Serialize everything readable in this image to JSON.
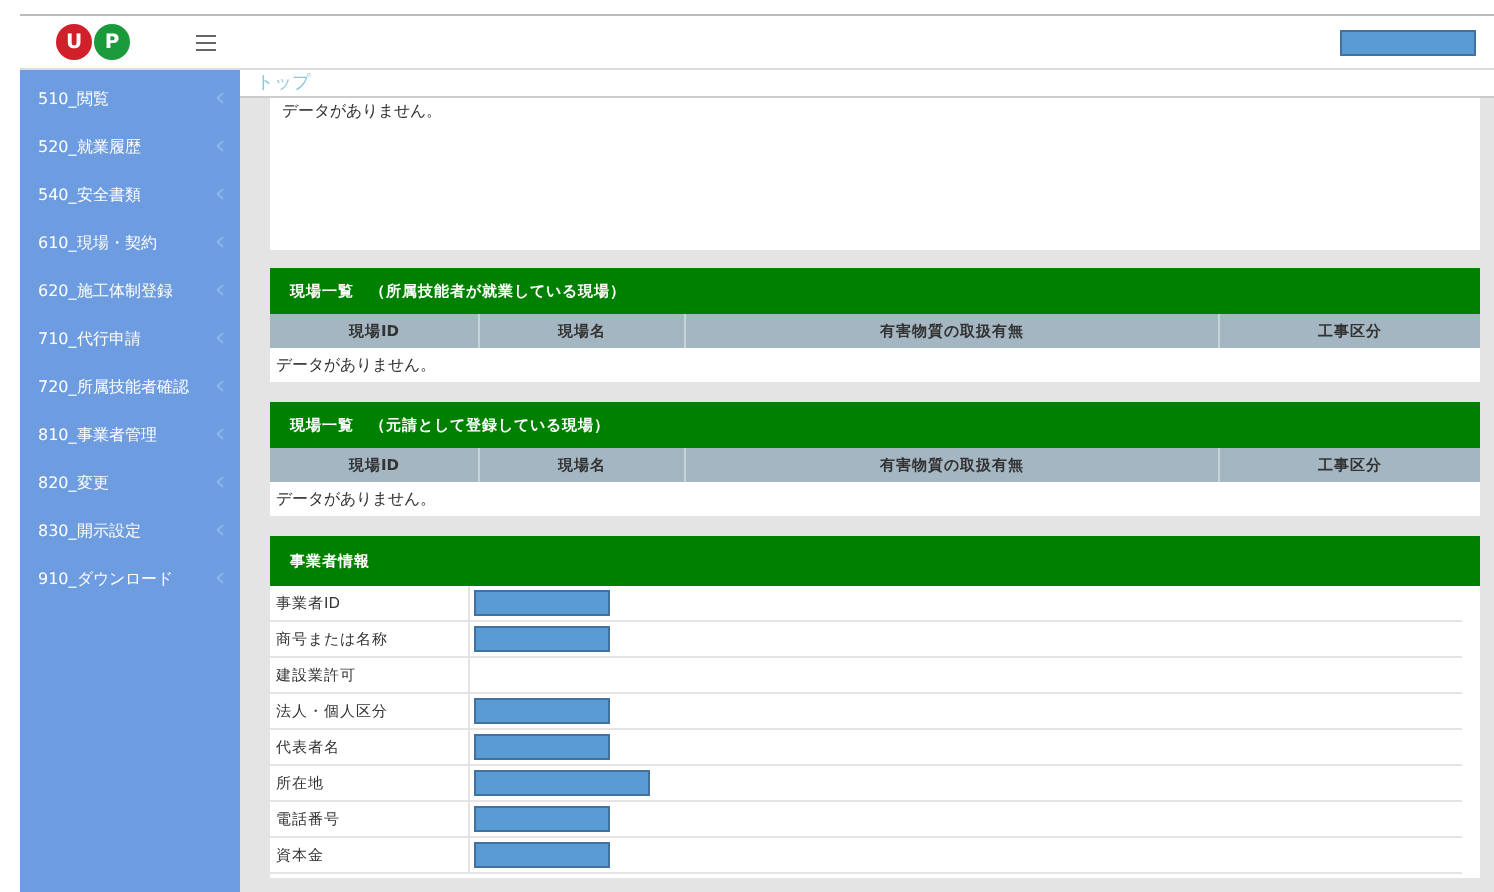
{
  "header": {
    "logo_letters": [
      "U",
      "P"
    ],
    "user_redacted": true
  },
  "sidebar": {
    "items": [
      {
        "label": "510_閲覧"
      },
      {
        "label": "520_就業履歴"
      },
      {
        "label": "540_安全書類"
      },
      {
        "label": "610_現場・契約"
      },
      {
        "label": "620_施工体制登録"
      },
      {
        "label": "710_代行申請"
      },
      {
        "label": "720_所属技能者確認"
      },
      {
        "label": "810_事業者管理"
      },
      {
        "label": "820_変更"
      },
      {
        "label": "830_開示設定"
      },
      {
        "label": "910_ダウンロード"
      }
    ]
  },
  "breadcrumb": "トップ",
  "top_panel": {
    "message": "データがありません。"
  },
  "site_tables": [
    {
      "title": "現場一覧　（所属技能者が就業している現場）",
      "columns": [
        "現場ID",
        "現場名",
        "有害物質の取扱有無",
        "工事区分"
      ],
      "empty_message": "データがありません。"
    },
    {
      "title": "現場一覧　（元請として登録している現場）",
      "columns": [
        "現場ID",
        "現場名",
        "有害物質の取扱有無",
        "工事区分"
      ],
      "empty_message": "データがありません。"
    }
  ],
  "company_info": {
    "title": "事業者情報",
    "rows": [
      {
        "label": "事業者ID",
        "redacted": true
      },
      {
        "label": "商号または名称",
        "redacted": true
      },
      {
        "label": "建設業許可",
        "redacted": false
      },
      {
        "label": "法人・個人区分",
        "redacted": true
      },
      {
        "label": "代表者名",
        "redacted": true
      },
      {
        "label": "所在地",
        "redacted": true,
        "wide": true
      },
      {
        "label": "電話番号",
        "redacted": true
      },
      {
        "label": "資本金",
        "redacted": true
      }
    ]
  }
}
